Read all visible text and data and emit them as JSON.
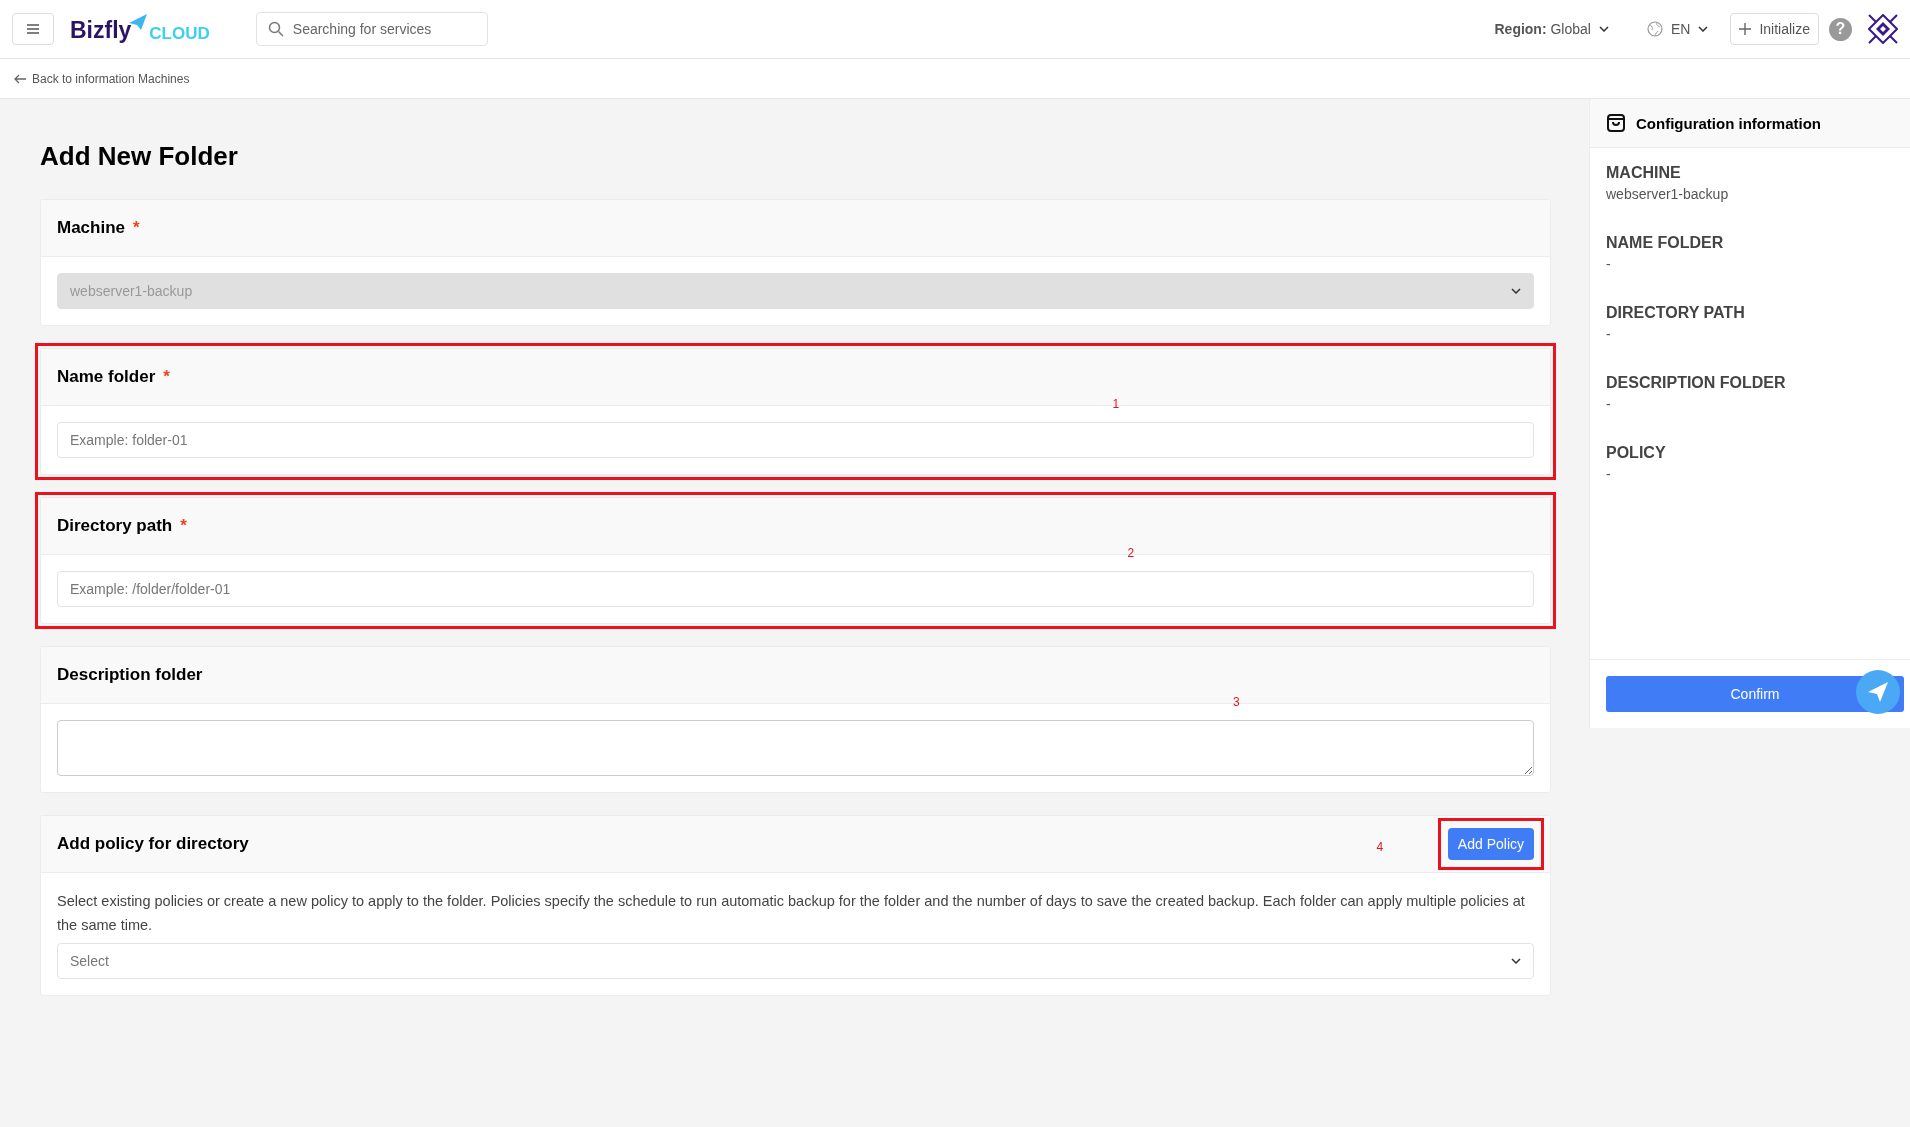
{
  "topbar": {
    "logo_main": "Bizfly",
    "logo_sub": "CLOUD",
    "search": {
      "placeholder": "Searching for services"
    },
    "region_label": "Region:",
    "region_value": "Global",
    "language": "EN",
    "initialize": "Initialize",
    "help": "?"
  },
  "breadcrumb": {
    "back": "Back to information Machines"
  },
  "page": {
    "title": "Add New Folder"
  },
  "sections": [
    {
      "kind": "select",
      "label": "Machine",
      "required_mark": "*",
      "value": "webserver1-backup",
      "disabled": true,
      "highlighted": false
    },
    {
      "kind": "input",
      "label": "Name folder",
      "required_mark": "*",
      "placeholder": "Example: folder-01",
      "annotation": "1",
      "highlighted": true
    },
    {
      "kind": "input",
      "label": "Directory path",
      "required_mark": "*",
      "placeholder": "Example: /folder/folder-01",
      "annotation": "2",
      "highlighted": true
    },
    {
      "kind": "textarea",
      "label": "Description folder",
      "annotation": "3",
      "highlighted": false
    },
    {
      "kind": "policy",
      "label": "Add policy for directory",
      "button": "Add Policy",
      "annotation": "4",
      "highlighted": true,
      "description": "Select existing policies or create a new policy to apply to the folder. Policies specify the schedule to run automatic backup for the folder and the number of days to save the created backup. Each folder can apply multiple policies at the same time.",
      "placeholder": "Select"
    }
  ],
  "summary": {
    "title": "Configuration information",
    "items": [
      {
        "label": "MACHINE",
        "value": "webserver1-backup"
      },
      {
        "label": "NAME FOLDER",
        "value": "-"
      },
      {
        "label": "DIRECTORY PATH",
        "value": "-"
      },
      {
        "label": "DESCRIPTION FOLDER",
        "value": "-"
      },
      {
        "label": "POLICY",
        "value": "-"
      }
    ],
    "confirm": "Confirm"
  }
}
